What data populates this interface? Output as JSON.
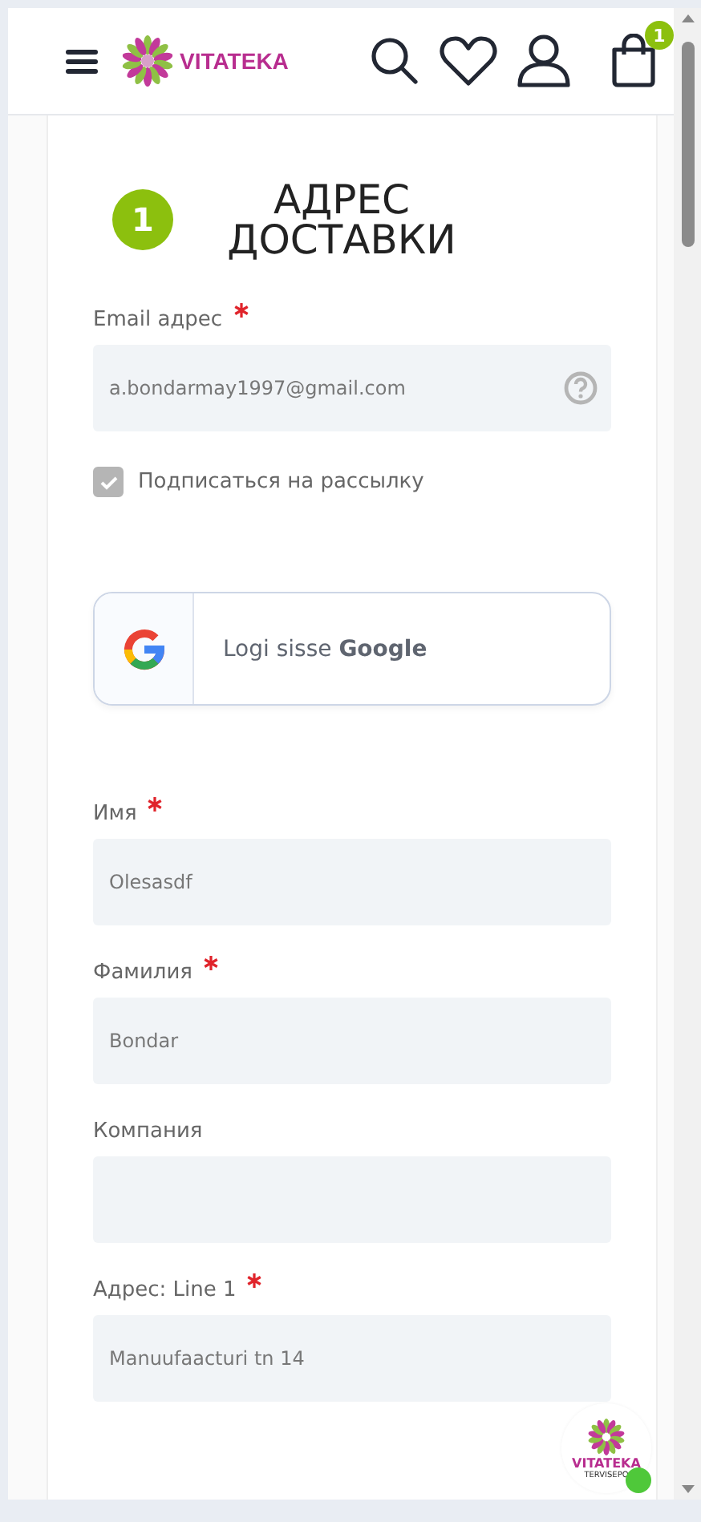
{
  "header": {
    "logo": "VITATEKA",
    "cart_count": "1"
  },
  "step": {
    "number": "1",
    "title": "АДРЕС ДОСТАВКИ"
  },
  "email": {
    "label": "Email адрес",
    "required": true,
    "value": "a.bondarmay1997@gmail.com"
  },
  "newsletter": {
    "label": "Подписаться на рассылку",
    "checked": true
  },
  "google_button": "Logi sisse **Google**",
  "fields": [
    {
      "label": "Имя",
      "required": true,
      "value": "Olesasdf"
    },
    {
      "label": "Фамилия",
      "required": true,
      "value": "Bondar"
    },
    {
      "label": "Компания",
      "required": false
    },
    {
      "label": "Адрес: Line 1",
      "required": true,
      "value": "Manuufaacturi tn 14"
    }
  ],
  "chat_widget": {
    "brand": "VITATEKA",
    "subtitle": "TERVISEPO",
    "online": true
  }
}
